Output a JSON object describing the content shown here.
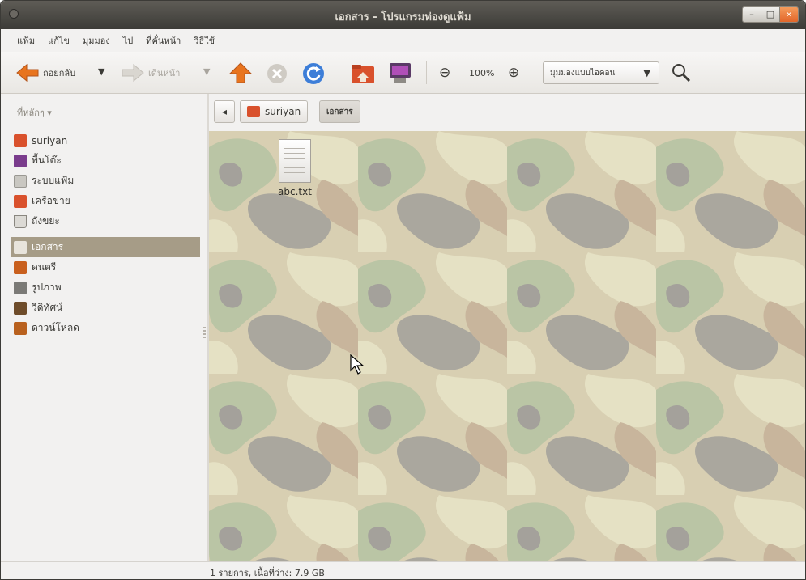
{
  "window": {
    "title": "เอกสาร - โปรแกรมท่องดูแฟ้ม",
    "controls": {
      "minimize": "–",
      "maximize": "□",
      "close": "×"
    }
  },
  "menu": [
    "แฟ้ม",
    "แก้ไข",
    "มุมมอง",
    "ไป",
    "ที่คั่นหน้า",
    "วิธีใช้"
  ],
  "toolbar": {
    "back_label": "ถอยกลับ",
    "forward_label": "เดินหน้า",
    "dropdown_glyph": "▼",
    "zoom_out_glyph": "⊖",
    "zoom_level": "100%",
    "zoom_in_glyph": "⊕",
    "view_mode": "มุมมองแบบไอคอน",
    "search_glyph": "🔍",
    "colors": {
      "up_arrow": "#e8741e",
      "back_arrow": "#e8741e",
      "reload": "#3d7ed8",
      "stop": "#c8c4bd"
    }
  },
  "sidebar": {
    "places_label": "ที่หลักๆ ▾",
    "items": [
      {
        "label": "suriyan",
        "icon": "home-folder-icon",
        "color": "#d9512c"
      },
      {
        "label": "พื้นโต๊ะ",
        "icon": "desktop-icon",
        "color": "#7a3c8c"
      },
      {
        "label": "ระบบแฟ้ม",
        "icon": "filesystem-icon",
        "color": "#9a9892"
      },
      {
        "label": "เครือข่าย",
        "icon": "network-icon",
        "color": "#d9512c"
      },
      {
        "label": "ถังขยะ",
        "icon": "trash-icon",
        "color": "#8a8780"
      },
      {
        "label": "เอกสาร",
        "icon": "documents-folder-icon",
        "color": "#e8e4dc",
        "selected": true
      },
      {
        "label": "ดนตรี",
        "icon": "music-folder-icon",
        "color": "#c9601e"
      },
      {
        "label": "รูปภาพ",
        "icon": "pictures-folder-icon",
        "color": "#7b7a76"
      },
      {
        "label": "วีดิทัศน์",
        "icon": "videos-folder-icon",
        "color": "#6e4c2a"
      },
      {
        "label": "ดาวน์โหลด",
        "icon": "downloads-folder-icon",
        "color": "#b9611e"
      }
    ]
  },
  "pathbar": {
    "back_glyph": "◂",
    "crumbs": [
      {
        "label": "suriyan"
      },
      {
        "label": "เอกสาร"
      }
    ]
  },
  "content": {
    "files": [
      {
        "name": "abc.txt",
        "icon": "text-file-icon"
      }
    ]
  },
  "status": {
    "text": "1 รายการ, เนื้อที่ว่าง: 7.9 GB"
  }
}
